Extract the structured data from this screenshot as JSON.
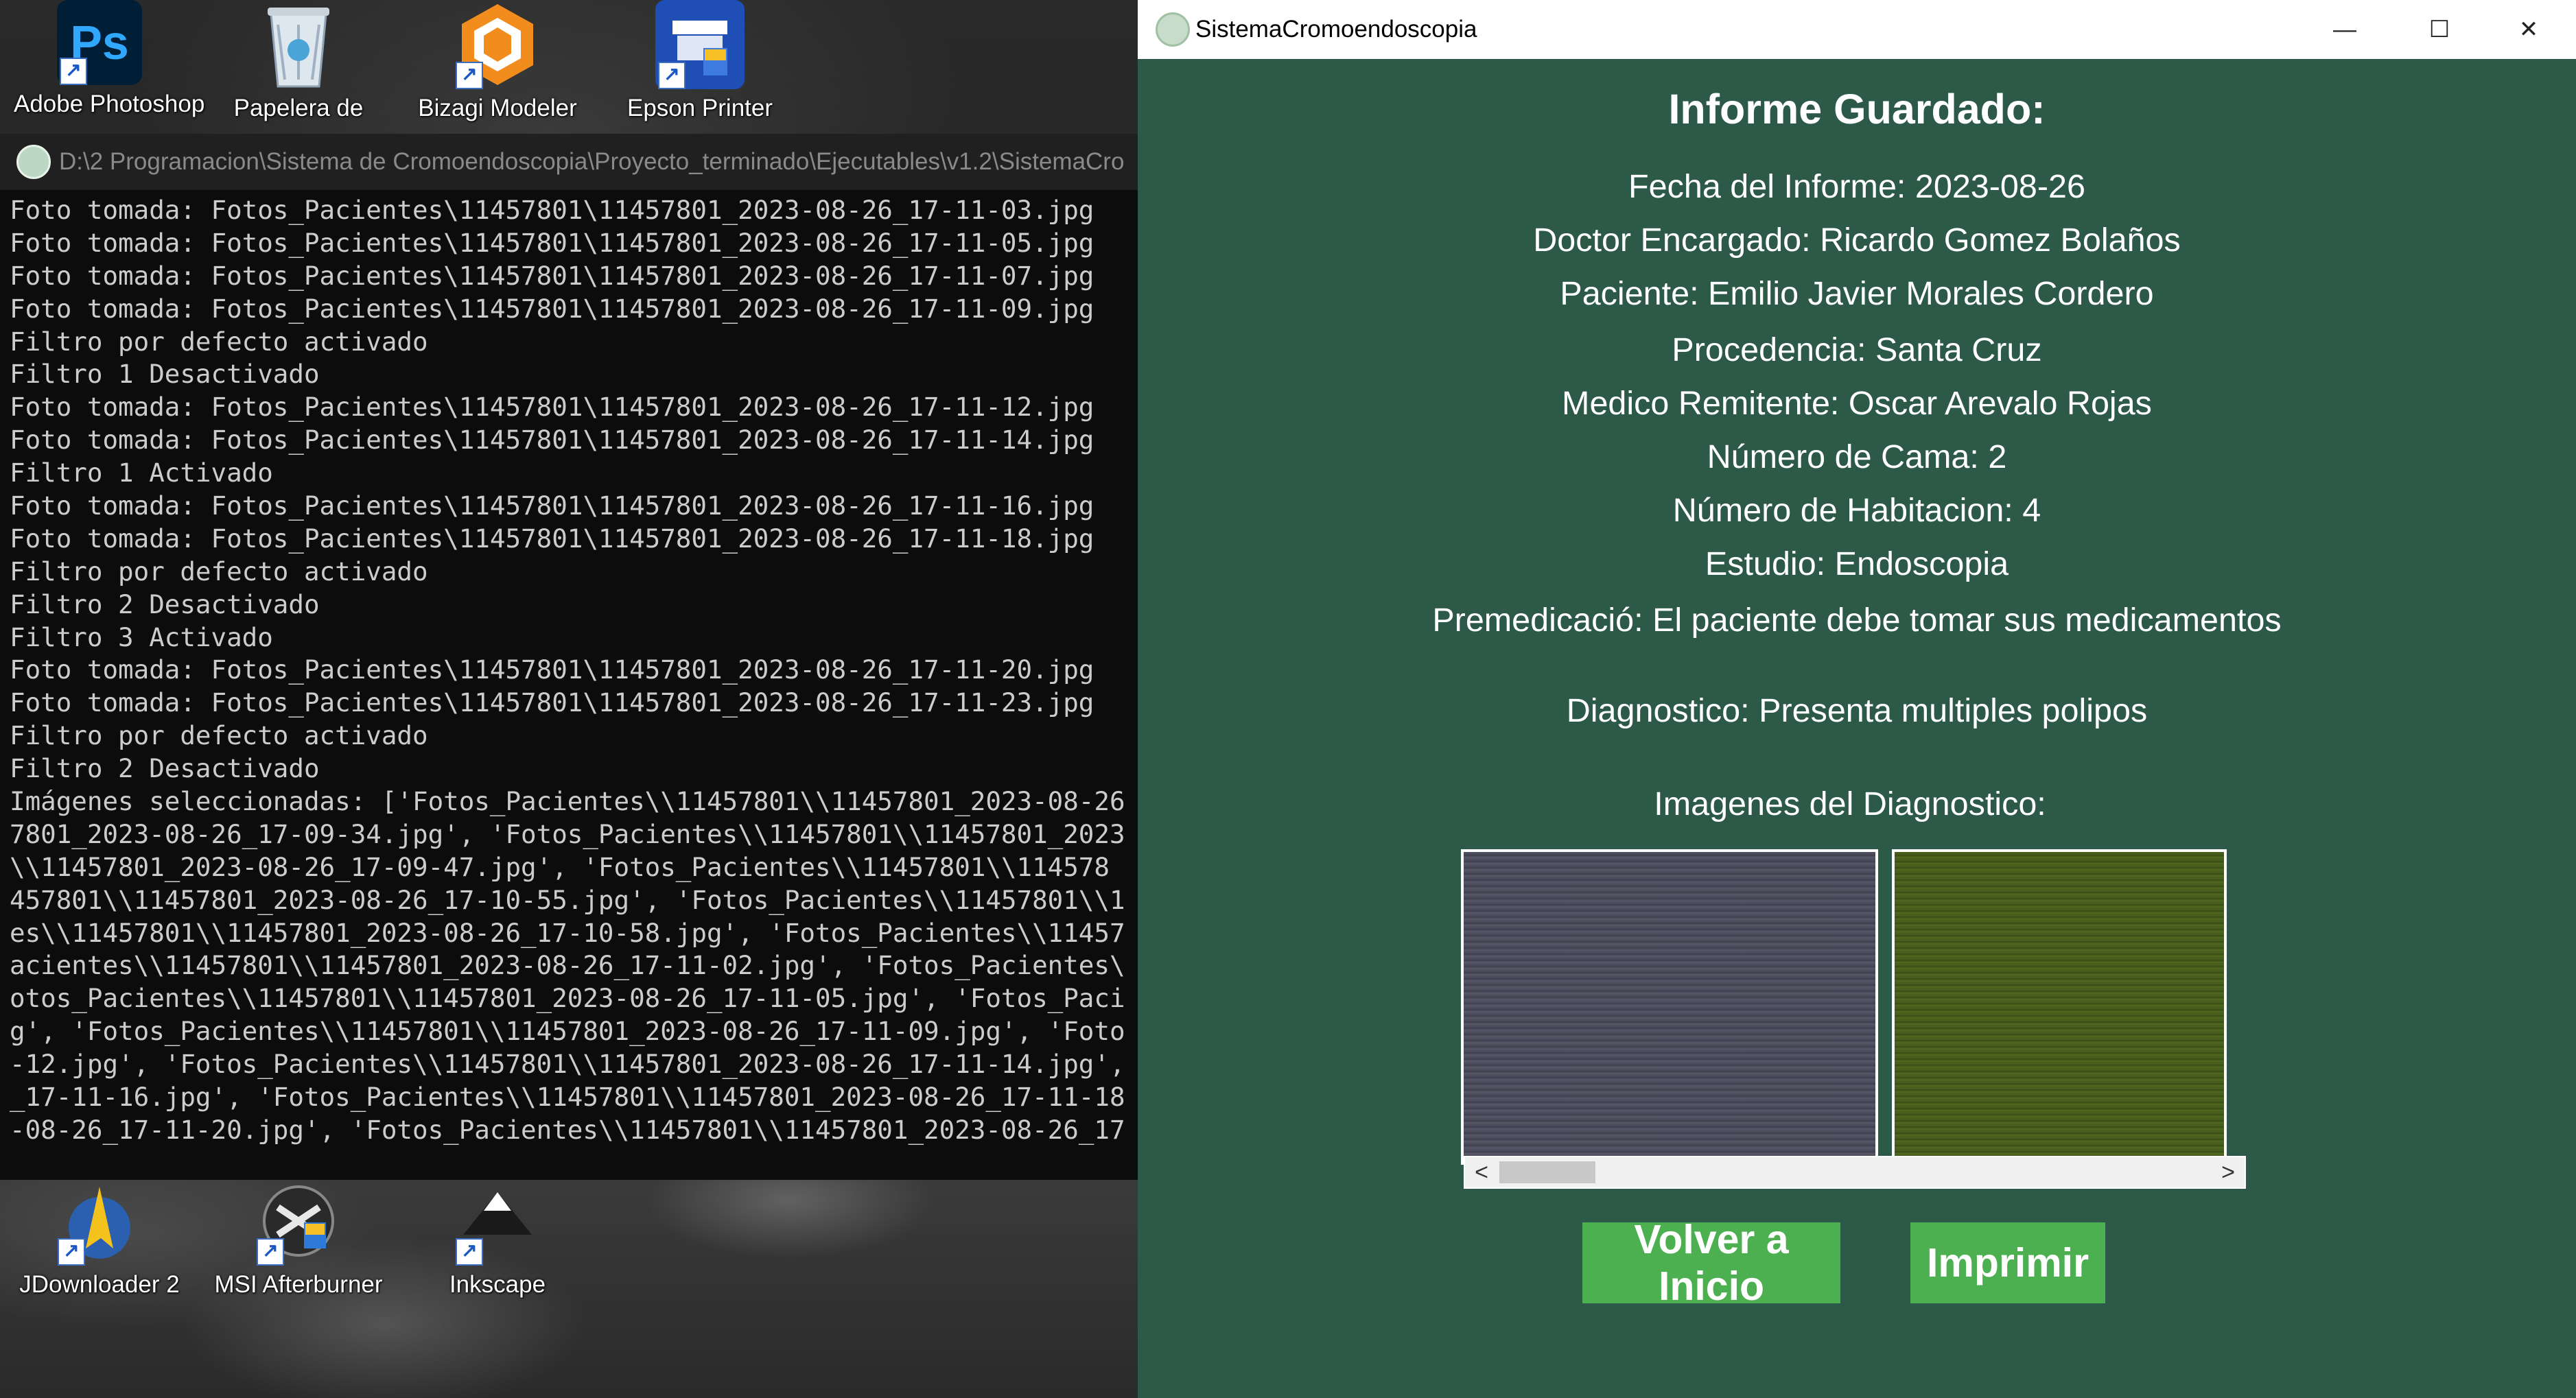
{
  "desktop": {
    "icons_top": [
      {
        "label": "Adobe Photoshop",
        "glyph": "Ps"
      },
      {
        "label": "Papelera de",
        "glyph": "recycle-bin"
      },
      {
        "label": "Bizagi Modeler",
        "glyph": "bizagi"
      },
      {
        "label": "Epson Printer",
        "glyph": "printer"
      }
    ],
    "icons_bottom": [
      {
        "label": "JDownloader 2",
        "glyph": "jdownloader"
      },
      {
        "label": "MSI Afterburner",
        "glyph": "afterburner"
      },
      {
        "label": "Inkscape",
        "glyph": "inkscape"
      }
    ]
  },
  "console": {
    "title": "D:\\2 Programacion\\Sistema de Cromoendoscopia\\Proyecto_terminado\\Ejecutables\\v1.2\\SistemaCro",
    "lines": [
      "Foto tomada: Fotos_Pacientes\\11457801\\11457801_2023-08-26_17-11-03.jpg",
      "Foto tomada: Fotos_Pacientes\\11457801\\11457801_2023-08-26_17-11-05.jpg",
      "Foto tomada: Fotos_Pacientes\\11457801\\11457801_2023-08-26_17-11-07.jpg",
      "Foto tomada: Fotos_Pacientes\\11457801\\11457801_2023-08-26_17-11-09.jpg",
      "Filtro por defecto activado",
      "Filtro 1 Desactivado",
      "Foto tomada: Fotos_Pacientes\\11457801\\11457801_2023-08-26_17-11-12.jpg",
      "Foto tomada: Fotos_Pacientes\\11457801\\11457801_2023-08-26_17-11-14.jpg",
      "Filtro 1 Activado",
      "Foto tomada: Fotos_Pacientes\\11457801\\11457801_2023-08-26_17-11-16.jpg",
      "Foto tomada: Fotos_Pacientes\\11457801\\11457801_2023-08-26_17-11-18.jpg",
      "Filtro por defecto activado",
      "Filtro 2 Desactivado",
      "Filtro 3 Activado",
      "Foto tomada: Fotos_Pacientes\\11457801\\11457801_2023-08-26_17-11-20.jpg",
      "Foto tomada: Fotos_Pacientes\\11457801\\11457801_2023-08-26_17-11-23.jpg",
      "Filtro por defecto activado",
      "Filtro 2 Desactivado",
      "Imágenes seleccionadas: ['Fotos_Pacientes\\\\11457801\\\\11457801_2023-08-26",
      "7801_2023-08-26_17-09-34.jpg', 'Fotos_Pacientes\\\\11457801\\\\11457801_2023",
      "\\\\11457801_2023-08-26_17-09-47.jpg', 'Fotos_Pacientes\\\\11457801\\\\114578",
      "457801\\\\11457801_2023-08-26_17-10-55.jpg', 'Fotos_Pacientes\\\\11457801\\\\1",
      "es\\\\11457801\\\\11457801_2023-08-26_17-10-58.jpg', 'Fotos_Pacientes\\\\11457",
      "acientes\\\\11457801\\\\11457801_2023-08-26_17-11-02.jpg', 'Fotos_Pacientes\\",
      "otos_Pacientes\\\\11457801\\\\11457801_2023-08-26_17-11-05.jpg', 'Fotos_Paci",
      "g', 'Fotos_Pacientes\\\\11457801\\\\11457801_2023-08-26_17-11-09.jpg', 'Foto",
      "-12.jpg', 'Fotos_Pacientes\\\\11457801\\\\11457801_2023-08-26_17-11-14.jpg',",
      "_17-11-16.jpg', 'Fotos_Pacientes\\\\11457801\\\\11457801_2023-08-26_17-11-18",
      "-08-26_17-11-20.jpg', 'Fotos_Pacientes\\\\11457801\\\\11457801_2023-08-26_17"
    ]
  },
  "app": {
    "title": "SistemaCromoendoscopia",
    "window_controls": {
      "minimize": "—",
      "maximize": "☐",
      "close": "✕"
    },
    "heading": "Informe Guardado:",
    "fields": {
      "fecha": "Fecha del Informe: 2023-08-26",
      "doctor": "Doctor Encargado: Ricardo Gomez Bolaños",
      "paciente": "Paciente: Emilio Javier Morales Cordero",
      "procedencia": "Procedencia: Santa Cruz",
      "medico": "Medico Remitente: Oscar Arevalo Rojas",
      "cama": "Número de Cama: 2",
      "habitacion": "Número de Habitacion: 4",
      "estudio": "Estudio: Endoscopia",
      "premedicacion": "Premedicació: El paciente debe tomar sus medicamentos",
      "diagnostico": "Diagnostico: Presenta multiples polipos"
    },
    "images_label": "Imagenes del Diagnostico:",
    "scroll": {
      "left": "<",
      "right": ">"
    },
    "buttons": {
      "home": "Volver a Inicio",
      "print": "Imprimir"
    },
    "colors": {
      "background": "#2d5a48",
      "button": "#4caf50"
    }
  }
}
